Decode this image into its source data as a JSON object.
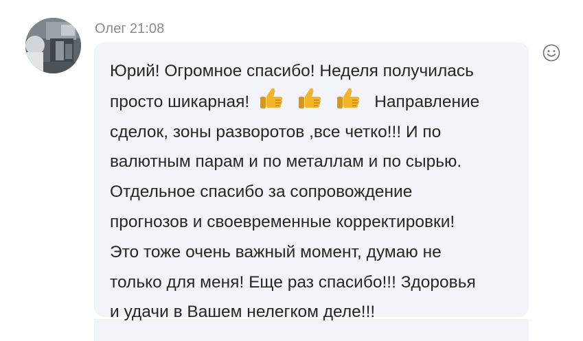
{
  "message": {
    "author": "Олег",
    "time": "21:08",
    "lines": [
      "Юрий! Огромное спасибо! Неделя получилась",
      "просто шикарная!",
      "Направление",
      "сделок, зоны разворотов ,все четко!!! И по",
      "валютным парам и по металлам и по сырью.",
      "Отдельное спасибо за сопровождение",
      "прогнозов и своевременные корректировки!",
      "Это тоже очень важный момент, думаю не",
      "только для меня! Еще раз спасибо!!! Здоровья",
      "и удачи в Вашем нелегком деле!!!"
    ],
    "inline_icons": [
      "thumbs-up-icon",
      "thumbs-up-icon",
      "thumbs-up-icon"
    ]
  },
  "colors": {
    "bubble_bg": "#f1f5f9",
    "meta_text": "#8a8a8a",
    "message_text": "#262626",
    "thumb_yellow": "#f2b52a"
  },
  "actions": {
    "reaction_icon": "smiley-icon"
  }
}
